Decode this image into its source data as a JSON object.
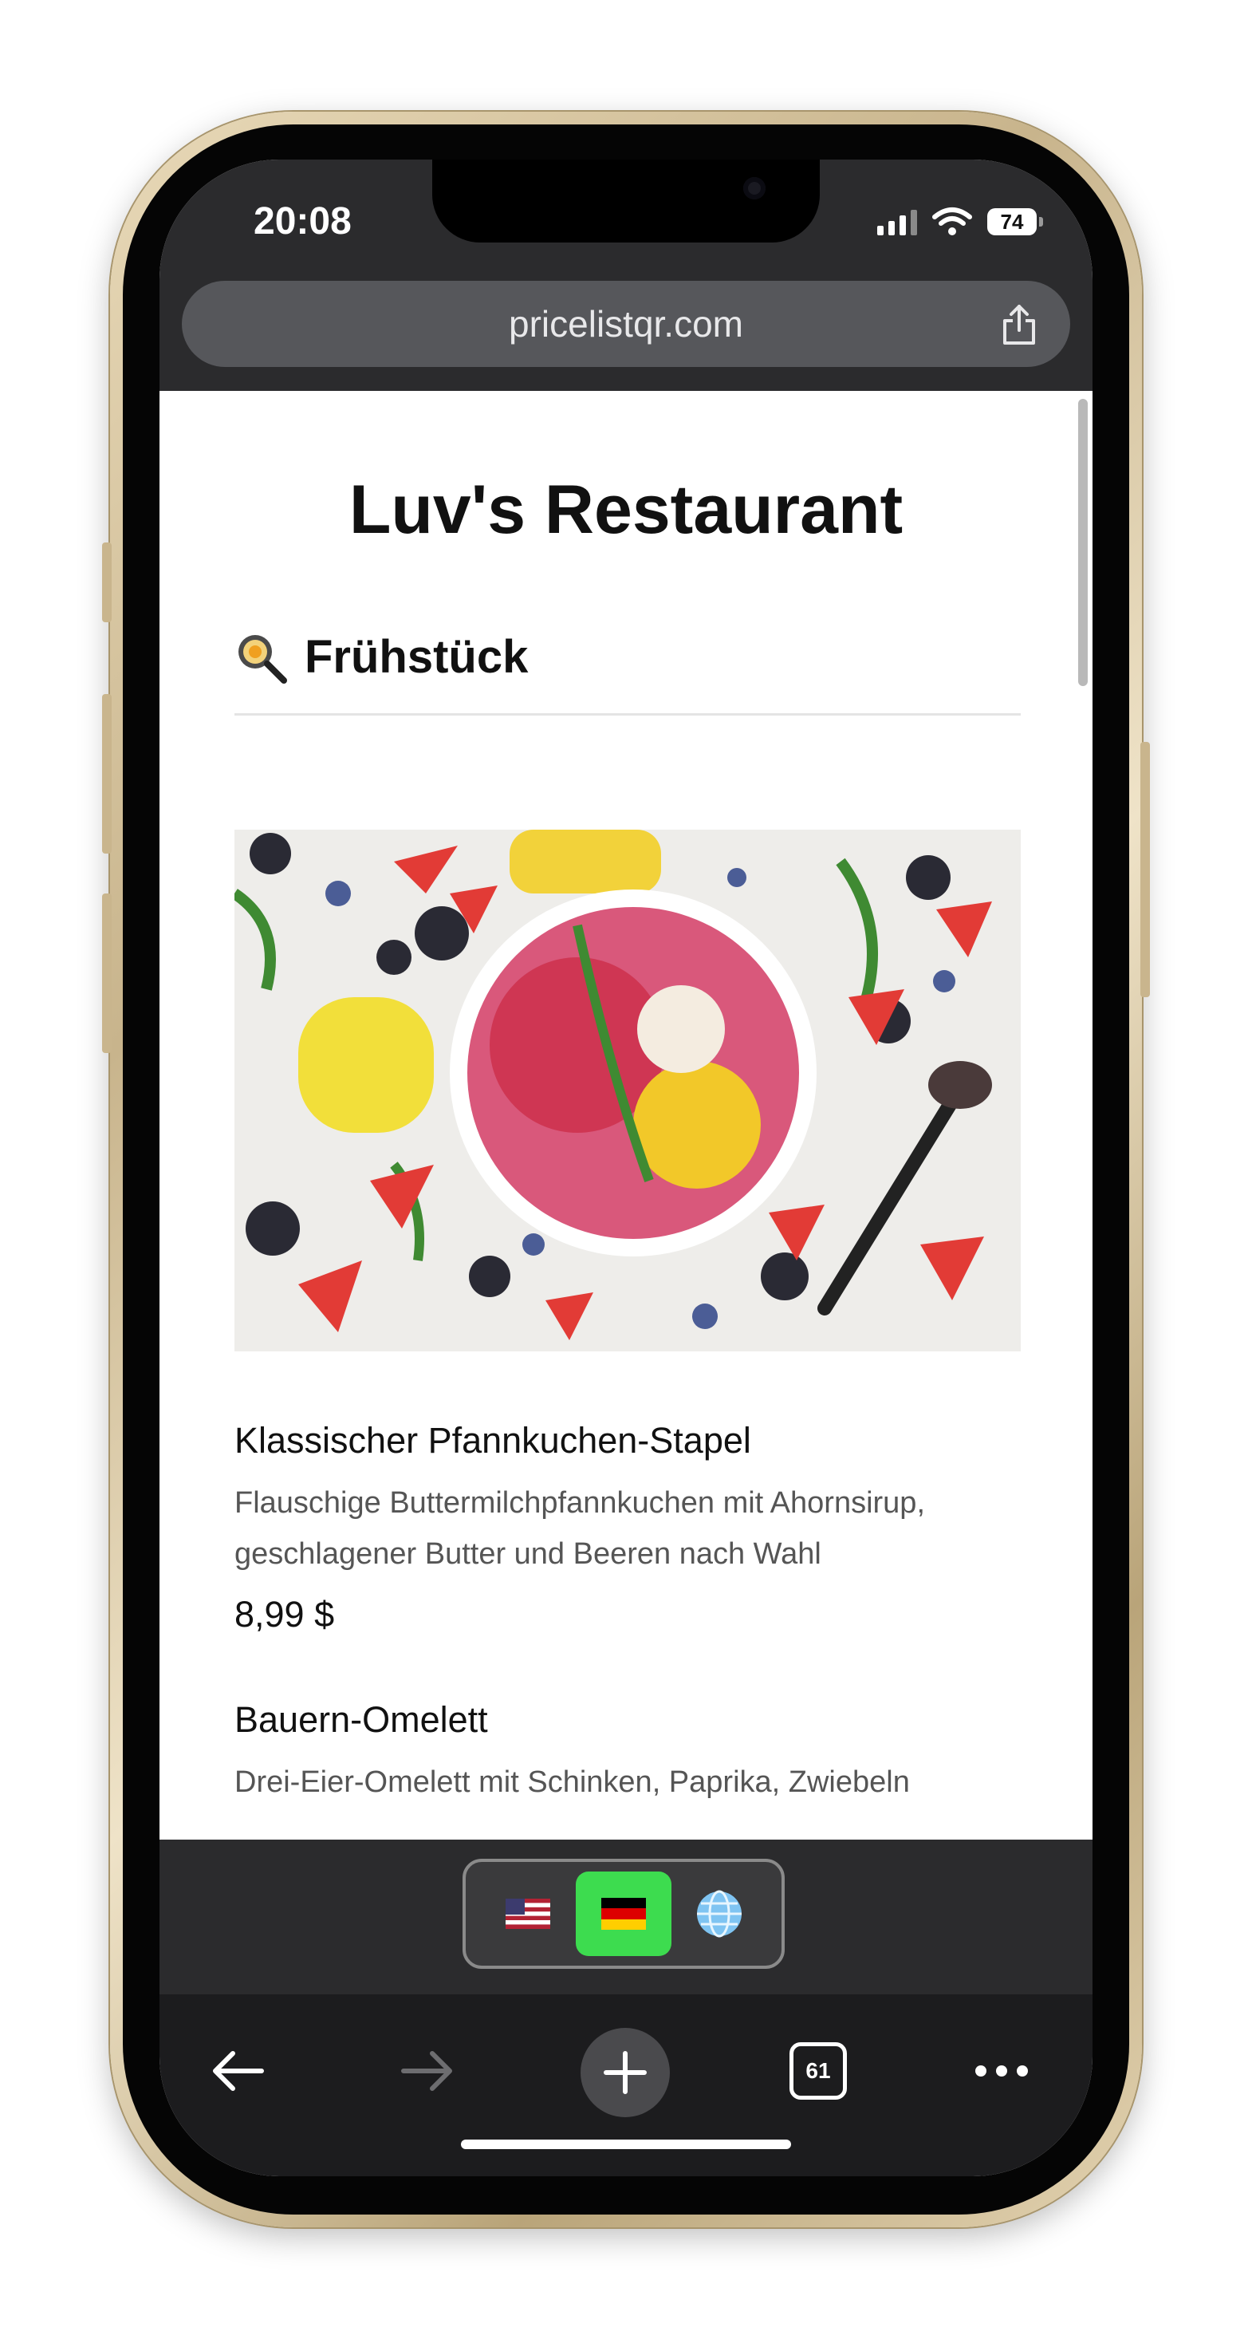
{
  "status": {
    "time": "20:08",
    "battery": "74"
  },
  "browser": {
    "url": "pricelistqr.com",
    "tab_count": "61"
  },
  "page": {
    "title": "Luv's Restaurant",
    "section": {
      "icon": "frying-pan-icon",
      "title": "Frühstück"
    },
    "items": [
      {
        "name": "Klassischer Pfannkuchen-Stapel",
        "description": "Flauschige Buttermilchpfannkuchen mit Ahornsirup, geschlagener Butter und Beeren nach Wahl",
        "price": "8,99 $"
      },
      {
        "name": "Bauern-Omelett",
        "description": "Drei-Eier-Omelett mit Schinken, Paprika, Zwiebeln"
      }
    ]
  },
  "language_switcher": {
    "options": [
      "us-flag-icon",
      "germany-flag-icon",
      "globe-icon"
    ],
    "selected": "germany-flag-icon",
    "active_color": "#3ddc4f"
  },
  "toolbar": {
    "icons": [
      "back-arrow-icon",
      "forward-arrow-icon",
      "new-tab-plus-icon",
      "tabs-counter-icon",
      "more-dots-icon"
    ]
  }
}
